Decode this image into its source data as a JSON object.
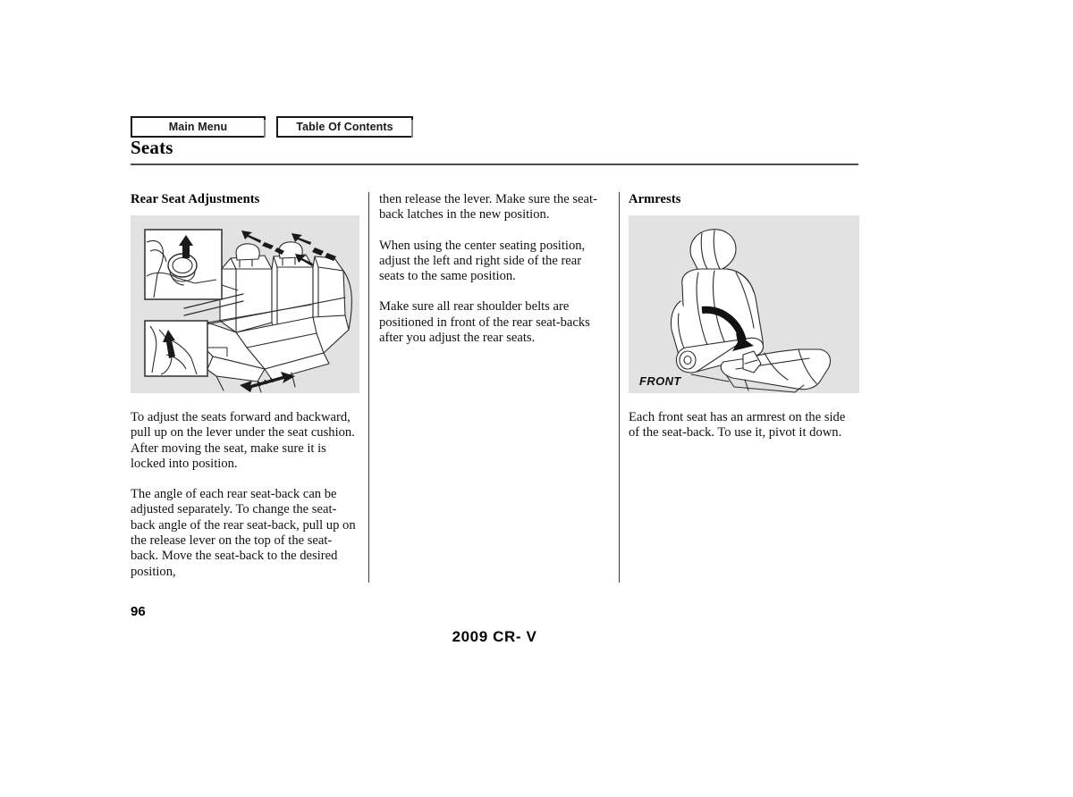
{
  "nav": {
    "main_menu_label": "Main Menu",
    "table_of_contents_label": "Table Of Contents"
  },
  "header": {
    "title": "Seats"
  },
  "columns": {
    "left": {
      "heading": "Rear Seat Adjustments",
      "figure_caption": "",
      "paragraphs": [
        "To adjust the seats forward and backward, pull up on the lever under the seat cushion. After moving the seat, make sure it is locked into position.",
        "The angle of each rear seat-back can be adjusted separately. To change the seat-back angle of the rear seat-back, pull up on the release lever on the top of the seat-back. Move the seat-back to the desired position,"
      ]
    },
    "middle": {
      "paragraphs": [
        "then release the lever. Make sure the seat-back latches in the new position.",
        "When using the center seating position, adjust the left and right side of the rear seats to the same position.",
        "Make sure all rear shoulder belts are positioned in front of the rear seat-backs after you adjust the rear seats."
      ]
    },
    "right": {
      "heading": "Armrests",
      "figure_label": "FRONT",
      "paragraphs": [
        "Each front seat has an armrest on the side of the seat-back. To use it, pivot it down."
      ]
    }
  },
  "footer": {
    "page_number": "96",
    "model": "2009  CR- V"
  },
  "colors": {
    "figure_background": "#e2e2e2",
    "rule": "#4d4d4d",
    "text": "#111111",
    "border": "#1a1a1a"
  }
}
